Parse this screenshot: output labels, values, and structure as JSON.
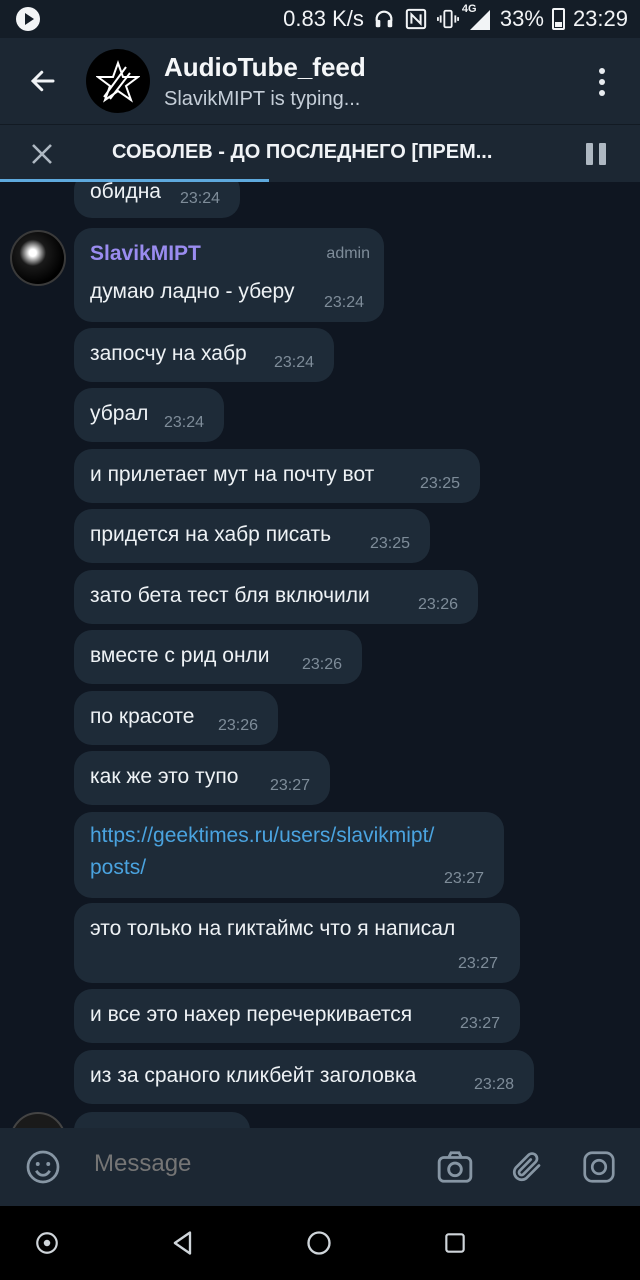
{
  "status": {
    "speed": "0.83 K/s",
    "network": "4G",
    "battery": "33%",
    "time": "23:29"
  },
  "header": {
    "title": "AudioTube_feed",
    "subtitle": "SlavikMIPT is typing..."
  },
  "player": {
    "title": "СОБОЛЕВ - ДО ПОСЛЕДНЕГО [ПРЕМ...",
    "progress": 0.42
  },
  "messages": [
    {
      "text": "обидна",
      "time": "23:24"
    },
    {
      "sender": "SlavikMIPT",
      "role": "admin",
      "text": "думаю ладно - уберу",
      "time": "23:24"
    },
    {
      "text": "запосчу на хабр",
      "time": "23:24"
    },
    {
      "text": "убрал",
      "time": "23:24"
    },
    {
      "text": "и прилетает мут на почту вот",
      "time": "23:25"
    },
    {
      "text": "придется на хабр писать",
      "time": "23:25"
    },
    {
      "text": "зато бета тест бля включили",
      "time": "23:26"
    },
    {
      "text": "вместе с рид онли",
      "time": "23:26"
    },
    {
      "text": "по красоте",
      "time": "23:26"
    },
    {
      "text": "как же это тупо",
      "time": "23:27"
    },
    {
      "text_line1": "https://geektimes.ru/users/slavikmipt/",
      "text_line2": "posts/",
      "time": "23:27"
    },
    {
      "text": "это только на гиктаймс что я написал",
      "time": "23:27"
    },
    {
      "text": "и все это нахер перечеркивается",
      "time": "23:27"
    },
    {
      "text": "из за сраного кликбейт заголовка",
      "time": "23:28"
    }
  ],
  "input": {
    "placeholder": "Message"
  },
  "colors": {
    "bubble": "#1e2b38",
    "background": "#0f1621",
    "accent": "#5ea9dd",
    "sender": "#9a8cf0",
    "link": "#4aa3df"
  }
}
